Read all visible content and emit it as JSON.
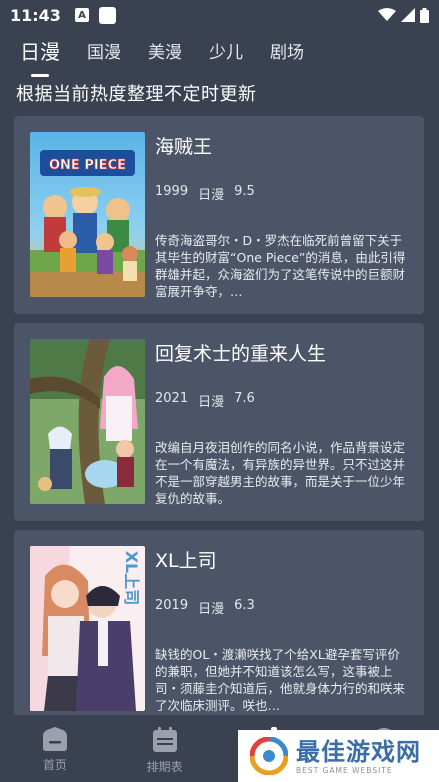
{
  "status": {
    "time": "11:43",
    "notification_letter": "A"
  },
  "tabs": [
    {
      "label": "日漫",
      "active": true
    },
    {
      "label": "国漫",
      "active": false
    },
    {
      "label": "美漫",
      "active": false
    },
    {
      "label": "少儿",
      "active": false
    },
    {
      "label": "剧场",
      "active": false
    }
  ],
  "subtitle": "根据当前热度整理不定时更新",
  "cards": [
    {
      "title": "海贼王",
      "year": "1999",
      "type": "日漫",
      "score": "9.5",
      "cover_logo": "ONE PIECE",
      "cover_icon": "one-piece-cover",
      "desc": "传奇海盗哥尔・D・罗杰在临死前曾留下关于其毕生的财富“One Piece”的消息，由此引得群雄并起，众海盗们为了这笔传说中的巨额财富展开争夺，…"
    },
    {
      "title": "回复术士的重来人生",
      "year": "2021",
      "type": "日漫",
      "score": "7.6",
      "cover_icon": "kaifuku-cover",
      "desc": "改编自月夜泪创作的同名小说，作品背景设定在一个有魔法，有异族的异世界。只不过这并不是一部穿越男主的故事，而是关于一位少年复仇的故事。"
    },
    {
      "title": "XL上司",
      "year": "2019",
      "type": "日漫",
      "score": "6.3",
      "cover_logo": "XL上司",
      "cover_icon": "xl-boss-cover",
      "desc": "缺钱的OL・渡濑咲找了个给XL避孕套写评价的兼职，但她并不知道该怎么写，这事被上司・须藤圭介知道后，他就身体力行的和咲来了次临床测评。咲也…"
    }
  ],
  "nav": [
    {
      "label": "首页",
      "icon": "home-icon"
    },
    {
      "label": "排期表",
      "icon": "calendar-icon"
    },
    {
      "label": "",
      "icon": "discover-icon"
    },
    {
      "label": "",
      "icon": "profile-icon"
    }
  ],
  "watermark": {
    "main": "最佳游戏网",
    "sub": "BEST GAME WEBSITE"
  },
  "colors": {
    "background": "#3a4150",
    "card": "#4c5567",
    "text": "#ffffff",
    "nav_inactive": "#9aa1ad",
    "watermark_blue": "#3b6ea8"
  }
}
